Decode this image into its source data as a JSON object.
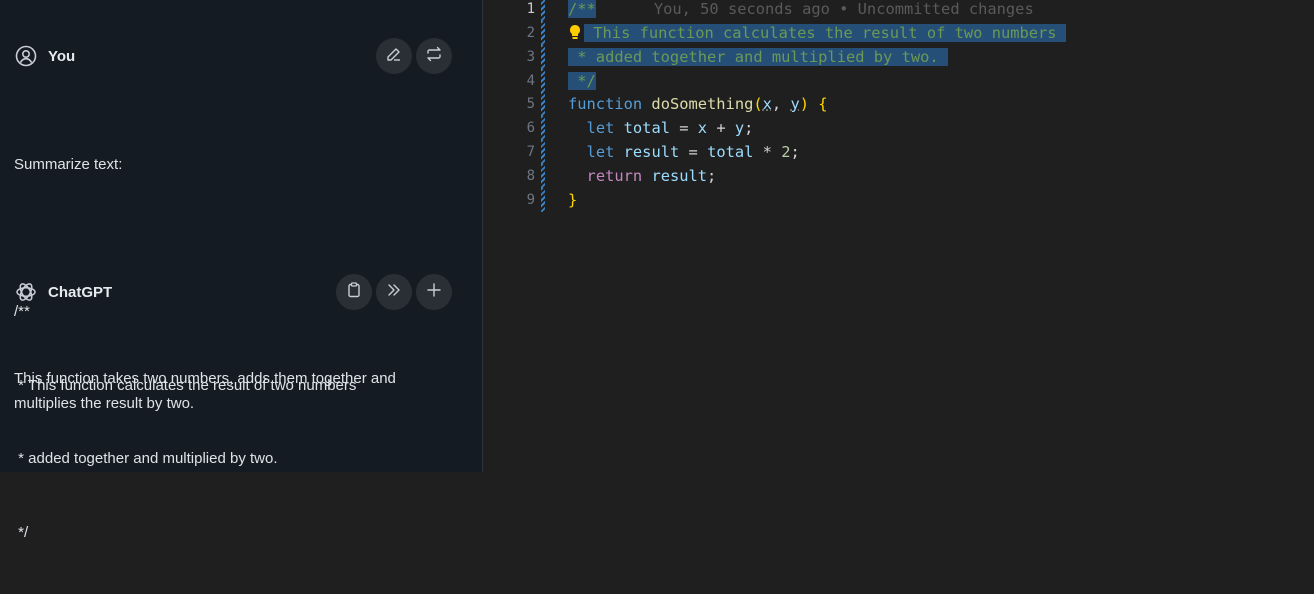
{
  "chat": {
    "user": {
      "name": "You",
      "message_lines": [
        "Summarize text:",
        "",
        "/**",
        " * This function calculates the result of two numbers",
        " * added together and multiplied by two.",
        " */"
      ],
      "actions": [
        "edit-icon",
        "swap-icon"
      ]
    },
    "assistant": {
      "name": "ChatGPT",
      "message": "This function takes two numbers, adds them together and multiplies the result by two.",
      "actions": [
        "clipboard-icon",
        "insert-icon",
        "plus-icon"
      ]
    }
  },
  "editor": {
    "blame": "You, 50 seconds ago • Uncommitted changes",
    "lines": [
      {
        "n": "1",
        "text": "/**"
      },
      {
        "n": "2",
        "text": " This function calculates the result of two numbers "
      },
      {
        "n": "3",
        "text": " * added together and multiplied by two. "
      },
      {
        "n": "4",
        "text": " */"
      },
      {
        "n": "5",
        "text": "function doSomething(x, y) {"
      },
      {
        "n": "6",
        "text": "  let total = x + y;"
      },
      {
        "n": "7",
        "text": "  let result = total * 2;"
      },
      {
        "n": "8",
        "text": "  return result;"
      },
      {
        "n": "9",
        "text": "}"
      }
    ],
    "tokens": {
      "function": "function",
      "fname": "doSomething",
      "open": "(",
      "x": "x",
      "comma": ", ",
      "y": "y",
      "close": ")",
      "brace_open": " {",
      "let": "let",
      "total": "total",
      "eq": " = ",
      "plus": " + ",
      "semi": ";",
      "result": "result",
      "times": " * ",
      "two": "2",
      "return": "return",
      "brace_close": "}"
    },
    "colors": {
      "selection": "#264f78",
      "comment": "#6a9955",
      "keyword": "#569cd6",
      "function": "#dcdcaa",
      "bracket": "#ffd700",
      "variable": "#9cdcfe",
      "number": "#b5cea8"
    }
  }
}
